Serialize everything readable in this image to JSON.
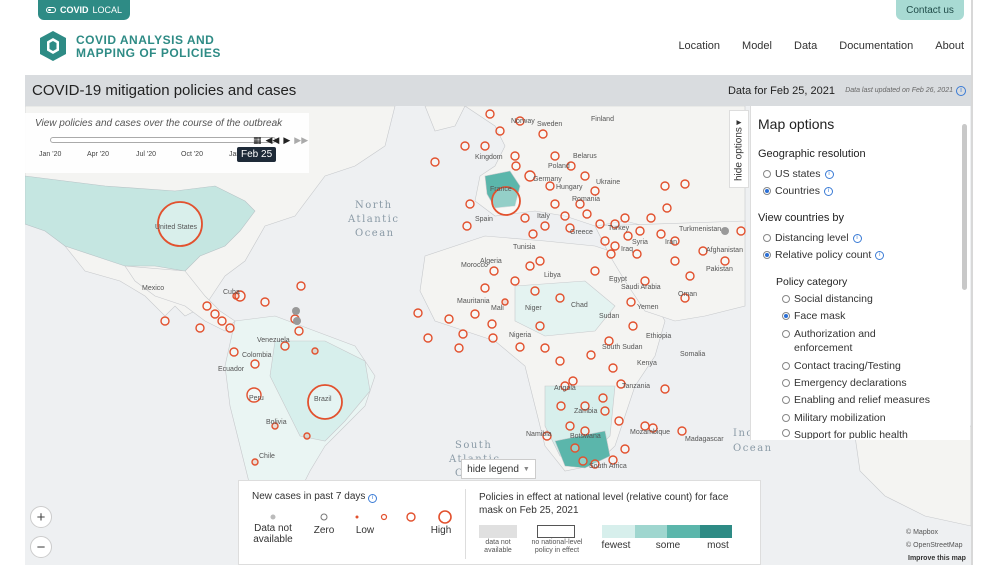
{
  "header": {
    "brand_tab": "LOCAL",
    "brand_tab_bold": "COVID",
    "contact": "Contact us",
    "logo_line1": "COVID ANALYSIS AND",
    "logo_line2": "MAPPING OF POLICIES",
    "nav": [
      "Location",
      "Model",
      "Data",
      "Documentation",
      "About"
    ]
  },
  "title_bar": {
    "title": "COVID-19 mitigation policies and cases",
    "data_for": "Data for Feb 25, 2021",
    "updated": "Data last updated on Feb 26, 2021"
  },
  "timeline": {
    "caption": "View policies and cases over the course of the outbreak",
    "ticks": [
      "Jan '20",
      "Apr '20",
      "Jul '20",
      "Oct '20",
      "Jan '21"
    ],
    "current": "Feb 25"
  },
  "options": {
    "hide_label": "hide options",
    "title": "Map options",
    "geo_label": "Geographic resolution",
    "geo": [
      "US states",
      "Countries"
    ],
    "view_label": "View countries by",
    "view": [
      "Distancing level",
      "Relative policy count"
    ],
    "cat_label": "Policy category",
    "categories": [
      "Social distancing",
      "Face mask",
      "Authorization and",
      "enforcement",
      "Contact tracing/Testing",
      "Emergency declarations",
      "Enabling and relief measures",
      "Military mobilization",
      "Support for public health"
    ]
  },
  "legend": {
    "hide_label": "hide legend",
    "cases_title": "New cases in past 7 days",
    "cases_items": [
      "Data not",
      "available",
      "Zero",
      "Low",
      "High"
    ],
    "policy_title_1": "Policies in effect at national level (relative count) for face",
    "policy_title_2": "mask on Feb 25, 2021",
    "policy_na_1": "data not",
    "policy_na_2": "available",
    "policy_none_1": "no national-level",
    "policy_none_2": "policy in effect",
    "scale": [
      "fewest",
      "some",
      "most"
    ]
  },
  "map": {
    "oceans": [
      "North",
      "Atlantic",
      "Ocean",
      "South",
      "Atlantic",
      "Ocean",
      "Inc",
      "Ocean"
    ],
    "countries": [
      "United States",
      "Mexico",
      "Cuba",
      "Venezuela",
      "Colombia",
      "Ecuador",
      "Peru",
      "Brazil",
      "Bolivia",
      "Chile",
      "Argentina",
      "Kingdom",
      "France",
      "Spain",
      "Italy",
      "Poland",
      "Germany",
      "Ukraine",
      "Hungary",
      "Romania",
      "Belarus",
      "Greece",
      "Turkey",
      "Syria",
      "Iraq",
      "Iran",
      "Turkmenistan",
      "Afghanistan",
      "Pakistan",
      "Saudi Arabia",
      "Oman",
      "Yemen",
      "Egypt",
      "Libya",
      "Tunisia",
      "Algeria",
      "Morocco",
      "Mauritania",
      "Mali",
      "Niger",
      "Chad",
      "Nigeria",
      "Sudan",
      "South Sudan",
      "Ethiopia",
      "Somalia",
      "Kenya",
      "Tanzania",
      "Zambia",
      "Namibia",
      "Botswana",
      "South Africa",
      "Mozambique",
      "Madagascar",
      "Angola",
      "Sweden",
      "Norway",
      "Finland"
    ],
    "attribution": [
      "© Mapbox",
      "© OpenStreetMap",
      "Improve this map"
    ]
  },
  "colors": {
    "teal": "#2e8b85",
    "water": "#eef0f2",
    "land": "#f5f5f3",
    "case_ring": "#e2512e",
    "policy_scale": [
      "#d7efec",
      "#9fd6cf",
      "#5bb6ab",
      "#2e8b85"
    ]
  }
}
